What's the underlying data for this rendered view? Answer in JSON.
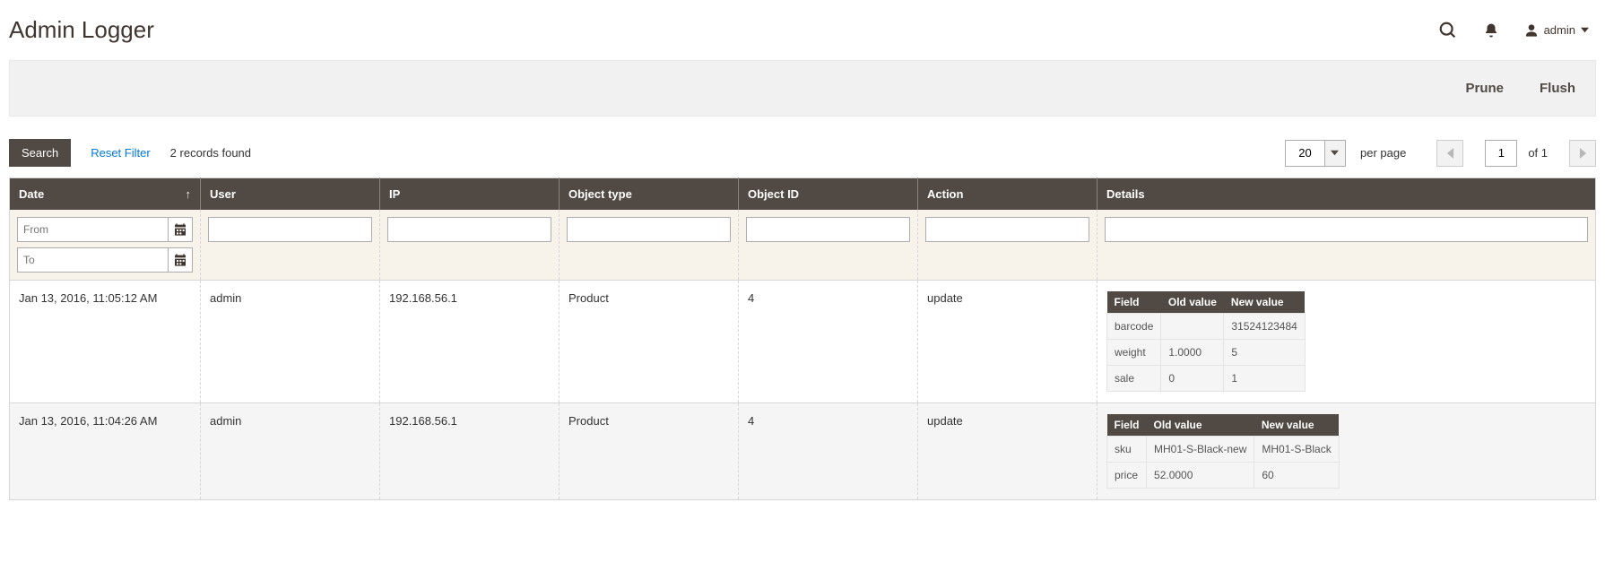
{
  "page": {
    "title": "Admin Logger",
    "user_label": "admin"
  },
  "toolbar": {
    "prune_label": "Prune",
    "flush_label": "Flush"
  },
  "controls": {
    "search_label": "Search",
    "reset_label": "Reset Filter",
    "records_found": "2 records found",
    "per_page_value": "20",
    "per_page_label": "per page",
    "page_value": "1",
    "of_pages": "of 1"
  },
  "columns": {
    "date": "Date",
    "user": "User",
    "ip": "IP",
    "object_type": "Object type",
    "object_id": "Object ID",
    "action": "Action",
    "details": "Details"
  },
  "filters": {
    "from_placeholder": "From",
    "to_placeholder": "To"
  },
  "details_cols": {
    "field": "Field",
    "old": "Old value",
    "new": "New value"
  },
  "rows": [
    {
      "date": "Jan 13, 2016, 11:05:12 AM",
      "user": "admin",
      "ip": "192.168.56.1",
      "object_type": "Product",
      "object_id": "4",
      "action": "update",
      "details": [
        {
          "field": "barcode",
          "old": "",
          "new": "31524123484"
        },
        {
          "field": "weight",
          "old": "1.0000",
          "new": "5"
        },
        {
          "field": "sale",
          "old": "0",
          "new": "1"
        }
      ]
    },
    {
      "date": "Jan 13, 2016, 11:04:26 AM",
      "user": "admin",
      "ip": "192.168.56.1",
      "object_type": "Product",
      "object_id": "4",
      "action": "update",
      "details": [
        {
          "field": "sku",
          "old": "MH01-S-Black-new",
          "new": "MH01-S-Black"
        },
        {
          "field": "price",
          "old": "52.0000",
          "new": "60"
        }
      ]
    }
  ]
}
